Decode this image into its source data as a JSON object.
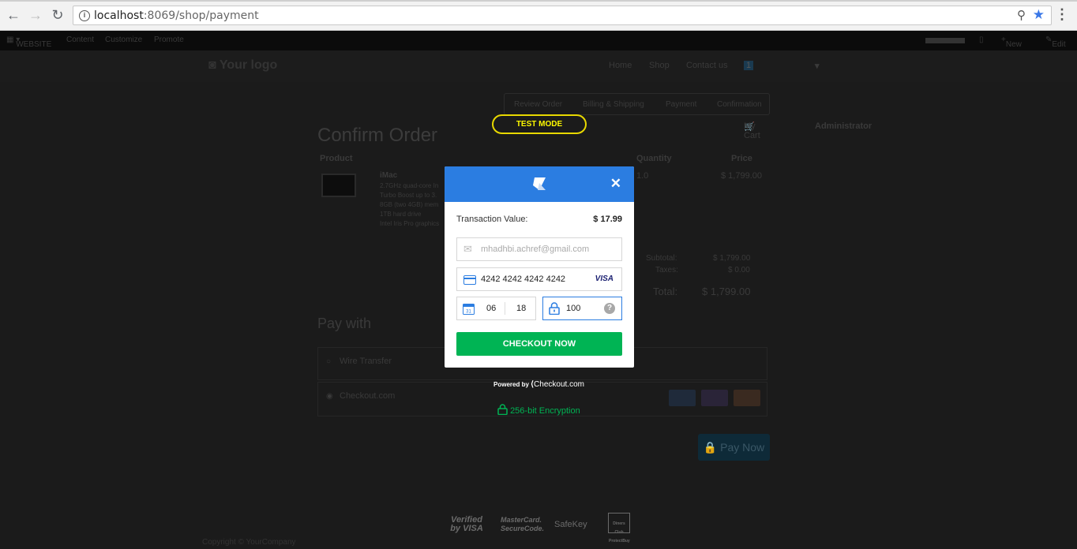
{
  "browser": {
    "url_host": "localhost",
    "url_rest": ":8069/shop/payment"
  },
  "adminbar": {
    "website": "WEBSITE",
    "content": "Content",
    "customize": "Customize",
    "promote": "Promote",
    "new": "New",
    "edit": "Edit"
  },
  "site": {
    "logo": "Your logo",
    "nav": [
      "Home",
      "Shop",
      "Contact us",
      "My Cart",
      "Administrator"
    ],
    "cart_count": "1"
  },
  "steps": [
    "Review Order",
    "Billing & Shipping",
    "Payment",
    "Confirmation"
  ],
  "order": {
    "title": "Confirm Order",
    "col_product": "Product",
    "col_quantity": "Quantity",
    "col_price": "Price",
    "item_name": "iMac",
    "item_desc": [
      "2.7GHz quad-core In",
      "Turbo Boost up to 3.",
      "8GB (two 4GB) mem",
      "1TB hard drive",
      "Intel Iris Pro graphics"
    ],
    "item_qty": "1.0",
    "item_price": "$ 1,799.00",
    "subtotal_label": "Subtotal:",
    "subtotal": "$ 1,799.00",
    "taxes_label": "Taxes:",
    "taxes": "$ 0.00",
    "total_label": "Total:",
    "total": "$ 1,799.00"
  },
  "pay_with": {
    "title": "Pay with",
    "options": [
      "Wire Transfer",
      "Checkout.com"
    ],
    "pay_now": "Pay Now"
  },
  "modal": {
    "test_mode": "TEST MODE",
    "transaction_label": "Transaction Value:",
    "transaction_value": "$ 17.99",
    "email": "mhadhbi.achref@gmail.com",
    "card_number": "4242 4242 4242 4242",
    "card_brand": "VISA",
    "exp_month": "06",
    "exp_year": "18",
    "cvv": "100",
    "checkout_button": "CHECKOUT NOW",
    "powered_by": "Powered by",
    "powered_brand": "Checkout.com",
    "encryption": "256-bit Encryption"
  },
  "footer": {
    "logos": [
      "Verified by VISA",
      "MasterCard. SecureCode.",
      "SafeKey",
      "Diners Club ProtectBuy"
    ],
    "copyright": "Copyright © YourCompany"
  }
}
